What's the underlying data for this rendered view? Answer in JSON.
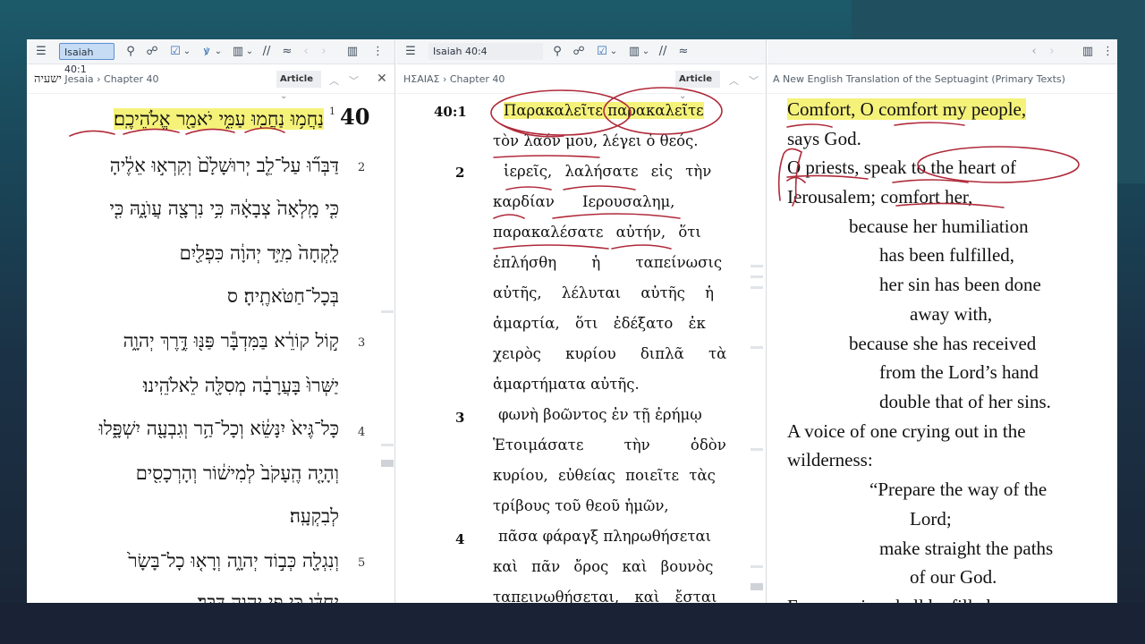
{
  "colors": {
    "accent": "#5b8fd1",
    "highlight": "#f5f27a",
    "ink": "#b02a3a"
  },
  "panels": [
    {
      "id": "hebrew",
      "toolbar": {
        "ref_value": "Isaiah 40:1"
      },
      "breadcrumb": {
        "title": "ישעיה",
        "book": "Jesaia",
        "sep": "›",
        "chapter": "Chapter 40"
      },
      "article_label": "Article",
      "chapter_number": "40",
      "verse_1_number": "1",
      "lines": [
        {
          "verse": "",
          "text": "נַחֲמ֥וּ נַחֲמ֖וּ עַמִּ֑י יֹאמַ֖ר אֱלֹהֵיכֶֽם׃"
        },
        {
          "verse": "2",
          "text": "דַּבְּר֞וּ עַל־לֵ֤ב יְרוּשָׁלַ֙͏ִם֙ וְקִרְא֣וּ אֵלֶ֔יהָ"
        },
        {
          "verse": "",
          "text": "כִּ֤י מָֽלְאָה֙ צְבָאָ֔הּ כִּ֥י נִרְצָ֖ה עֲוֺנָ֑הּ כִּ֤י"
        },
        {
          "verse": "",
          "text": "לָֽקְחָה֙ מִיַּ֣ד יְהוָ֔ה כִּפְלַ֖יִם"
        },
        {
          "verse": "",
          "text": "בְּכָל־חַטֹּאתֶֽיהָ׃ ס"
        },
        {
          "verse": "3",
          "text": "ק֣וֹל קוֹרֵ֔א בַּמִּדְבָּ֕ר פַּנּ֖וּ דֶּ֣רֶךְ יְהוָ֑ה"
        },
        {
          "verse": "",
          "text": "יַשְּׁרוּ֙ בָּעֲרָבָ֔ה מְסִלָּ֖ה לֵאלֹהֵֽינוּ׃"
        },
        {
          "verse": "4",
          "text": "כָּל־גֶּיא֙ יִנָּשֵׂ֔א וְכָל־הַ֥ר וְגִבְעָ֖ה יִשְׁפָּ֑לוּ"
        },
        {
          "verse": "",
          "text": "וְהָיָ֤ה הֶֽעָקֹב֙ לְמִישׁ֔וֹר וְהָרְכָסִ֖ים"
        },
        {
          "verse": "",
          "text": "לְבִקְעָֽה׃"
        },
        {
          "verse": "5",
          "text": "וְנִגְלָ֖ה כְּב֣וֹד יְהוָ֑ה וְרָא֤וּ כָל־בָּשָׂר֙"
        },
        {
          "verse": "",
          "text": "יַחְדָּ֔ו כִּ֛י פִּ֥י יְהוָ֖ה דִּבֵּֽר׃"
        }
      ]
    },
    {
      "id": "greek",
      "toolbar": {
        "ref_value": "Isaiah 40:4"
      },
      "breadcrumb": {
        "title": "ΗΣΑΙΑΣ",
        "sep": "›",
        "chapter": "Chapter 40"
      },
      "article_label": "Article",
      "lines": [
        {
          "verse": "40:1",
          "text": "Παρακαλεῖτε παρακαλεῖτε"
        },
        {
          "verse": "",
          "text": "τὸν λαόν μου, λέγει ὁ θεός."
        },
        {
          "verse": "2",
          "text": "ἱερεῖς, λαλήσατε εἰς τὴν"
        },
        {
          "verse": "",
          "text": "καρδίαν Ιερουσαλημ,"
        },
        {
          "verse": "",
          "text": "παρακαλέσατε αὐτήν, ὅτι"
        },
        {
          "verse": "",
          "text": "ἐπλήσθη ἡ ταπείνωσις"
        },
        {
          "verse": "",
          "text": "αὐτῆς, λέλυται αὐτῆς ἡ"
        },
        {
          "verse": "",
          "text": "ἁμαρτία, ὅτι ἐδέξατο ἐκ"
        },
        {
          "verse": "",
          "text": "χειρὸς κυρίου διπλᾶ τὰ"
        },
        {
          "verse": "",
          "text": "ἁμαρτήματα αὐτῆς."
        },
        {
          "verse": "3",
          "text": "φωνὴ βοῶντος ἐν τῇ ἐρήμῳ"
        },
        {
          "verse": "",
          "text": "Ἑτοιμάσατε τὴν ὁδὸν"
        },
        {
          "verse": "",
          "text": "κυρίου, εὐθείας ποιεῖτε τὰς"
        },
        {
          "verse": "",
          "text": "τρίβους τοῦ θεοῦ ἡμῶν,"
        },
        {
          "verse": "4",
          "text": "πᾶσα φάραγξ πληρωθήσεται"
        },
        {
          "verse": "",
          "text": "καὶ πᾶν ὄρος καὶ βουνὸς"
        },
        {
          "verse": "",
          "text": "ταπεινωθήσεται, καὶ ἔσται"
        }
      ]
    },
    {
      "id": "english",
      "breadcrumb": {
        "title": "A New English Translation of the Septuagint (Primary Texts)"
      },
      "lines": [
        {
          "text": "Comfort, O comfort my people,"
        },
        {
          "text": "says God."
        },
        {
          "text": "O priests, speak to the heart of"
        },
        {
          "text": "Ierousalem; comfort her,"
        },
        {
          "text": "because her humiliation"
        },
        {
          "text": "has been fulfilled,"
        },
        {
          "text": "her sin has been done"
        },
        {
          "text": "away with,"
        },
        {
          "text": "because she has received"
        },
        {
          "text": "from the Lord’s hand"
        },
        {
          "text": "double that of her sins."
        },
        {
          "text": "A voice of one crying out in the"
        },
        {
          "text": "wilderness:"
        },
        {
          "text": "“Prepare the way of the"
        },
        {
          "text": "Lord;"
        },
        {
          "text": "make straight the paths"
        },
        {
          "text": "of our God."
        },
        {
          "text": "Every ravine shall be filled up,"
        }
      ]
    }
  ],
  "icons": {
    "menu": "☰",
    "search": "⚲",
    "people": "☍",
    "check": "☑",
    "caret": "⌄",
    "strike": "ꝟ",
    "columns": "▥",
    "slashes": "//",
    "back": "‹",
    "forward": "›",
    "more": "⋮",
    "up": "︿",
    "down": "﹀",
    "close": "✕",
    "approx": "≈"
  }
}
